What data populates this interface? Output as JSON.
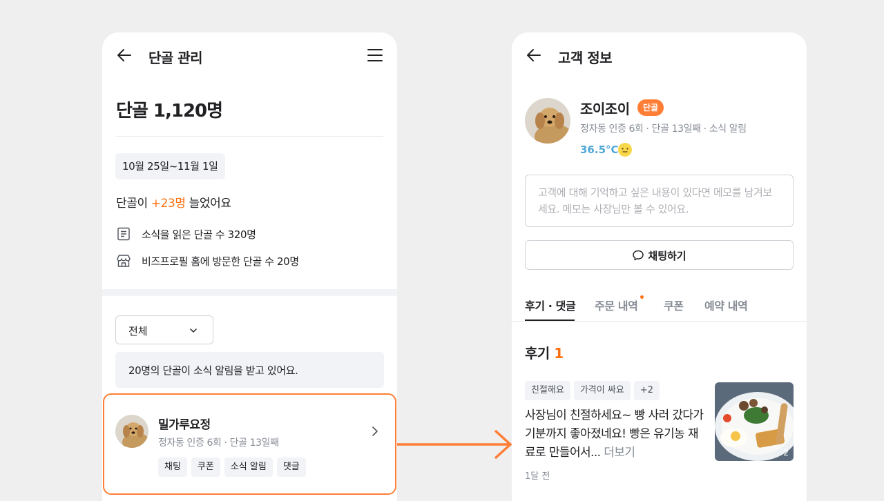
{
  "left_screen": {
    "header": {
      "title": "단골 관리"
    },
    "summary": {
      "count_label": "단골 1,120명",
      "date_range": "10월 25일~11월 1일",
      "growth_prefix": "단골이 ",
      "growth_value": "+23명",
      "growth_suffix": " 늘었어요"
    },
    "stats": [
      {
        "icon": "document-icon",
        "label": "소식을 읽은 단골 수 320명"
      },
      {
        "icon": "store-icon",
        "label": "비즈프로필 홈에 방문한 단골 수 20명"
      }
    ],
    "filter": {
      "selected": "전체"
    },
    "notice": "20명의 단골이 소식 알림을 받고 있어요.",
    "customer": {
      "name": "밀가루요정",
      "meta": "정자동 인증 6회 · 단골 13일째",
      "tags": [
        "채팅",
        "쿠폰",
        "소식 알림",
        "댓글"
      ]
    }
  },
  "right_screen": {
    "header": {
      "title": "고객 정보"
    },
    "profile": {
      "name": "조이조이",
      "badge": "단골",
      "meta": "정자동 인증 6회 · 단골 13일째 · 소식 알림",
      "temperature": "36.5°C"
    },
    "memo_placeholder": "고객에 대해 기억하고 싶은 내용이 있다면 메모를 남겨보세요. 메모는 사장님만 볼 수 있어요.",
    "chat_button": "채팅하기",
    "tabs": [
      "후기 · 댓글",
      "주문 내역",
      "쿠폰",
      "예약 내역"
    ],
    "reviews": {
      "title": "후기",
      "count": "1",
      "items": [
        {
          "tags": [
            "친절해요",
            "가격이 싸요",
            "+2"
          ],
          "text": "사장님이 친절하세요~ 빵 사러 갔다가 기분까지 좋아졌네요! 빵은 유기농 재료로 만들어서... ",
          "more": "더보기",
          "time": "1달 전",
          "photo_count": "2"
        }
      ]
    }
  },
  "colors": {
    "accent": "#ff6f0f",
    "highlight_border": "#ff7e36",
    "temperature": "#4fa8d8"
  }
}
